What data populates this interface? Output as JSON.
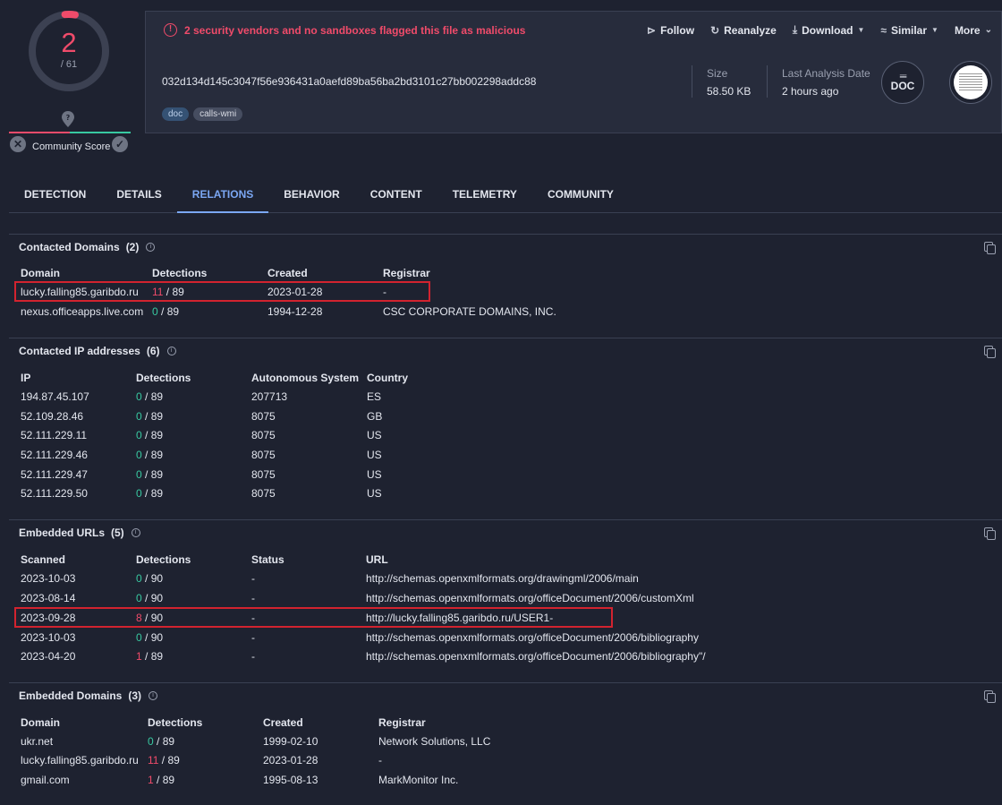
{
  "score": {
    "detected": "2",
    "total": "/ 61"
  },
  "community": {
    "label": "Community Score"
  },
  "alert": {
    "text": "2 security vendors and no sandboxes flagged this file as malicious"
  },
  "actions": [
    {
      "label": "Follow",
      "icon": "follow-icon"
    },
    {
      "label": "Reanalyze",
      "icon": "reanalyze-icon"
    },
    {
      "label": "Download",
      "icon": "download-icon"
    },
    {
      "label": "Similar",
      "icon": "similar-icon"
    },
    {
      "label": "More",
      "icon": "chevron-down-icon"
    }
  ],
  "file": {
    "hash": "032d134d145c3047f56e936431a0aefd89ba56ba2bd3101c27bb002298addc88",
    "tags": [
      "doc",
      "calls-wmi"
    ],
    "size_label": "Size",
    "size_value": "58.50 KB",
    "date_label": "Last Analysis Date",
    "date_value": "2 hours ago",
    "type": "DOC"
  },
  "tabs": [
    "DETECTION",
    "DETAILS",
    "RELATIONS",
    "BEHAVIOR",
    "CONTENT",
    "TELEMETRY",
    "COMMUNITY"
  ],
  "colors": {
    "malicious": "#f04b6a",
    "clean": "#38c9a1",
    "accent": "#7ba7f3",
    "highlight": "#d2232f"
  },
  "contacted_domains": {
    "title": "Contacted Domains",
    "count": "(2)",
    "headers": [
      "Domain",
      "Detections",
      "Created",
      "Registrar"
    ],
    "rows": [
      {
        "domain": "lucky.falling85.garibdo.ru",
        "det": "11",
        "det_total": " / 89",
        "created": "2023-01-28",
        "registrar": "-"
      },
      {
        "domain": "nexus.officeapps.live.com",
        "det": "0",
        "det_total": " / 89",
        "created": "1994-12-28",
        "registrar": "CSC CORPORATE DOMAINS, INC."
      }
    ]
  },
  "contacted_ips": {
    "title": "Contacted IP addresses",
    "count": "(6)",
    "headers": [
      "IP",
      "Detections",
      "Autonomous System",
      "Country"
    ],
    "rows": [
      {
        "ip": "194.87.45.107",
        "det": "0",
        "det_total": " / 89",
        "as": "207713",
        "country": "ES"
      },
      {
        "ip": "52.109.28.46",
        "det": "0",
        "det_total": " / 89",
        "as": "8075",
        "country": "GB"
      },
      {
        "ip": "52.111.229.11",
        "det": "0",
        "det_total": " / 89",
        "as": "8075",
        "country": "US"
      },
      {
        "ip": "52.111.229.46",
        "det": "0",
        "det_total": " / 89",
        "as": "8075",
        "country": "US"
      },
      {
        "ip": "52.111.229.47",
        "det": "0",
        "det_total": " / 89",
        "as": "8075",
        "country": "US"
      },
      {
        "ip": "52.111.229.50",
        "det": "0",
        "det_total": " / 89",
        "as": "8075",
        "country": "US"
      }
    ]
  },
  "embedded_urls": {
    "title": "Embedded URLs",
    "count": "(5)",
    "headers": [
      "Scanned",
      "Detections",
      "Status",
      "URL"
    ],
    "rows": [
      {
        "scanned": "2023-10-03",
        "det": "0",
        "det_total": " / 90",
        "status": "-",
        "url": "http://schemas.openxmlformats.org/drawingml/2006/main"
      },
      {
        "scanned": "2023-08-14",
        "det": "0",
        "det_total": " / 90",
        "status": "-",
        "url": "http://schemas.openxmlformats.org/officeDocument/2006/customXml"
      },
      {
        "scanned": "2023-09-28",
        "det": "8",
        "det_total": " / 90",
        "status": "-",
        "url": "http://lucky.falling85.garibdo.ru/USER1-"
      },
      {
        "scanned": "2023-10-03",
        "det": "0",
        "det_total": " / 90",
        "status": "-",
        "url": "http://schemas.openxmlformats.org/officeDocument/2006/bibliography"
      },
      {
        "scanned": "2023-04-20",
        "det": "1",
        "det_total": " / 89",
        "status": "-",
        "url": "http://schemas.openxmlformats.org/officeDocument/2006/bibliography\"/"
      }
    ]
  },
  "embedded_domains": {
    "title": "Embedded Domains",
    "count": "(3)",
    "headers": [
      "Domain",
      "Detections",
      "Created",
      "Registrar"
    ],
    "rows": [
      {
        "domain": "ukr.net",
        "det": "0",
        "det_total": " / 89",
        "created": "1999-02-10",
        "registrar": "Network Solutions, LLC"
      },
      {
        "domain": "lucky.falling85.garibdo.ru",
        "det": "11",
        "det_total": " / 89",
        "created": "2023-01-28",
        "registrar": "-"
      },
      {
        "domain": "gmail.com",
        "det": "1",
        "det_total": " / 89",
        "created": "1995-08-13",
        "registrar": "MarkMonitor Inc."
      }
    ]
  }
}
